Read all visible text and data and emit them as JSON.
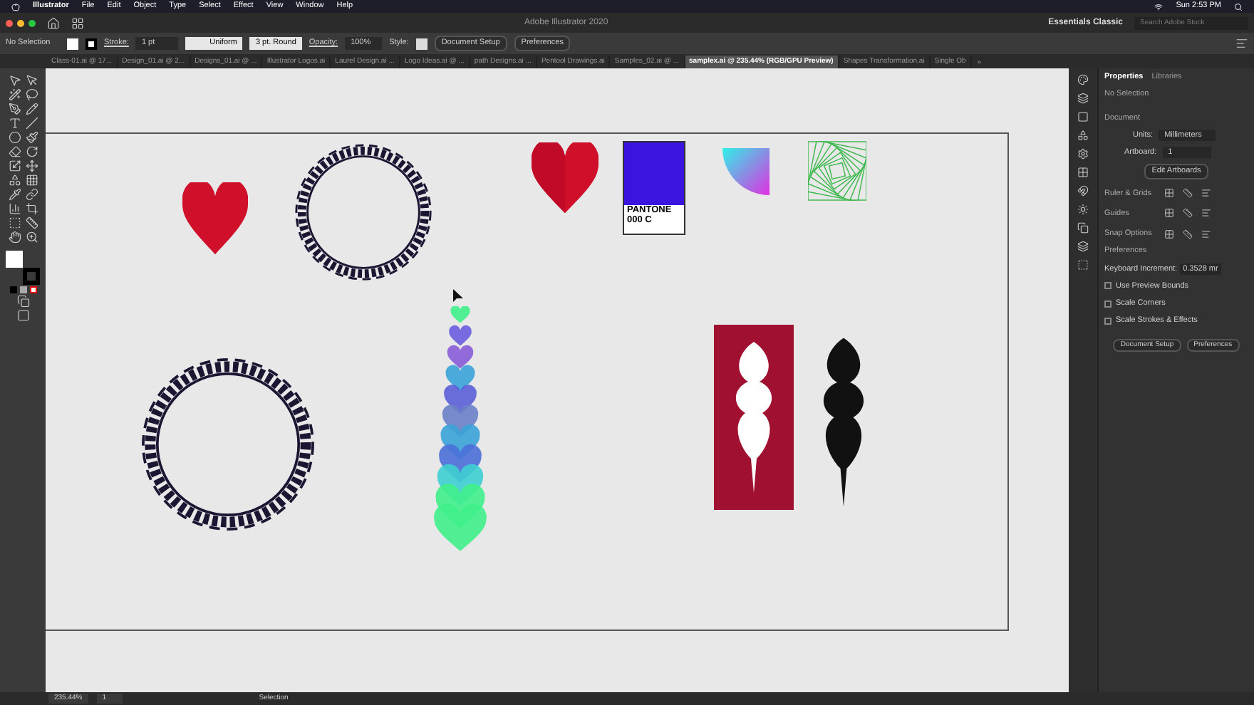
{
  "menu_bar": {
    "app": "Illustrator",
    "items": [
      "File",
      "Edit",
      "Object",
      "Type",
      "Select",
      "Effect",
      "View",
      "Window",
      "Help"
    ],
    "clock": "Sun 2:53 PM"
  },
  "title_bar": {
    "title": "Adobe Illustrator 2020",
    "workspace": "Essentials Classic",
    "search": {
      "placeholder": "Search Adobe Stock"
    }
  },
  "control_bar": {
    "selection": "No Selection",
    "stroke_label": "Stroke:",
    "stroke_weight": "1 pt",
    "profile": "Uniform",
    "brush": "3 pt. Round",
    "opacity_label": "Opacity:",
    "opacity": "100%",
    "style_label": "Style:",
    "buttons": [
      "Document Setup",
      "Preferences"
    ]
  },
  "tabs": [
    {
      "label": "Class-01.ai @ 17...",
      "selected": false
    },
    {
      "label": "Design_01.ai @ 2...",
      "selected": false
    },
    {
      "label": "Designs_01.ai @ ...",
      "selected": false
    },
    {
      "label": "Illustrator Logos.ai",
      "selected": false
    },
    {
      "label": "Laurel Design.ai ...",
      "selected": false
    },
    {
      "label": "Logo Ideas.ai @ ...",
      "selected": false
    },
    {
      "label": "path Designs.ai ...",
      "selected": false
    },
    {
      "label": "Pentool Drawings.ai",
      "selected": false
    },
    {
      "label": "Samples_02.ai @ ...",
      "selected": false
    },
    {
      "label": "samplex.ai @ 235.44% (RGB/GPU Preview)",
      "selected": true
    },
    {
      "label": "Shapes Transformation.ai",
      "selected": false
    },
    {
      "label": "Single Ob",
      "selected": false
    }
  ],
  "tabs_overflow": "»",
  "artwork": {
    "pantone_label": [
      "PANTONE",
      "000 C"
    ]
  },
  "properties_panel": {
    "tabs": [
      {
        "label": "Properties",
        "selected": true
      },
      {
        "label": "Libraries",
        "selected": false
      }
    ],
    "selection": "No Selection",
    "document": {
      "heading": "Document",
      "units_label": "Units:",
      "units": "Millimeters",
      "artboard_label": "Artboard:",
      "artboard": "1",
      "edit_button": "Edit Artboards"
    },
    "sections": [
      "Ruler & Grids",
      "Guides",
      "Snap Options"
    ],
    "preferences": {
      "heading": "Preferences",
      "keyboard_label": "Keyboard Increment:",
      "keyboard_value": "0.3528 mr",
      "checkboxes": [
        {
          "label": "Use Preview Bounds",
          "checked": false
        },
        {
          "label": "Scale Corners",
          "checked": false
        },
        {
          "label": "Scale Strokes & Effects",
          "checked": false
        }
      ]
    },
    "buttons": [
      "Document Setup",
      "Preferences"
    ]
  },
  "status_bar": {
    "zoom": "235.44%",
    "artboard": "1",
    "tool": "Selection"
  }
}
